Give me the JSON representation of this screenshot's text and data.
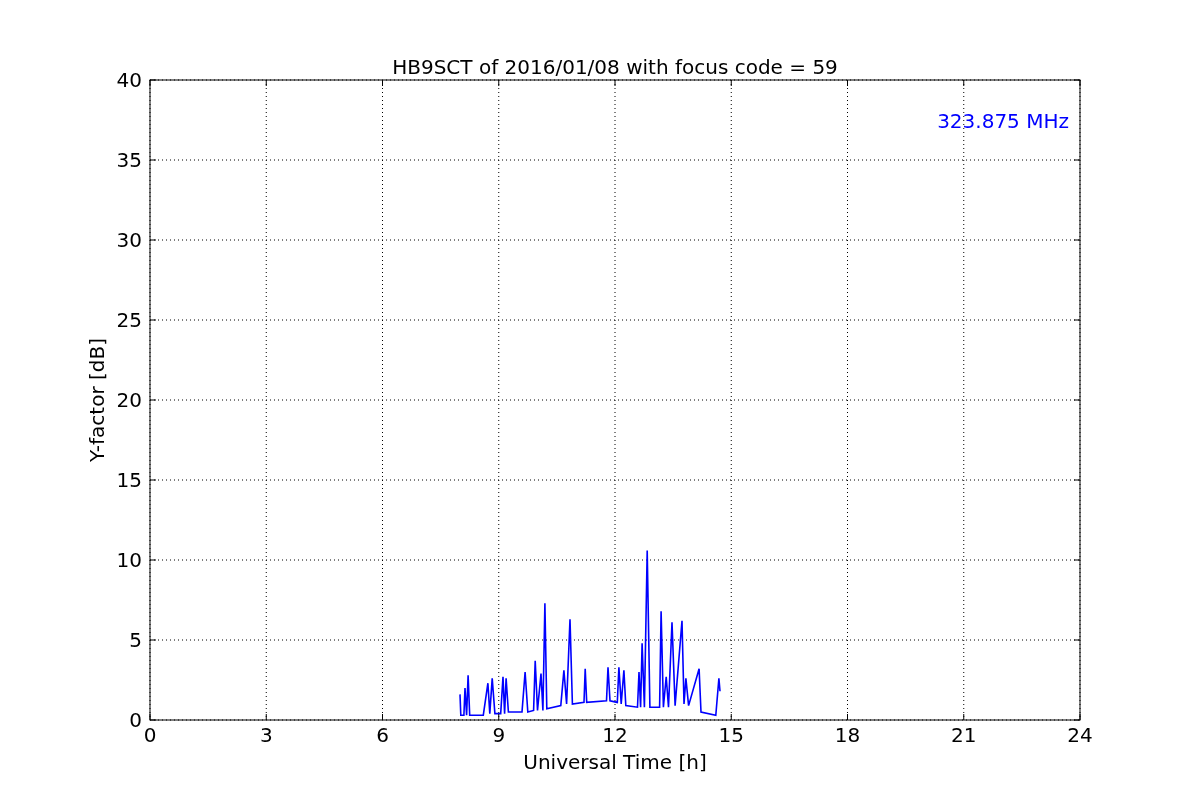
{
  "chart": {
    "chart_data": {
      "type": "line",
      "title": "HB9SCT of 2016/01/08 with focus code = 59",
      "xlabel": "Universal Time [h]",
      "ylabel": "Y-factor [dB]",
      "xlim": [
        0,
        24
      ],
      "ylim": [
        0,
        40
      ],
      "xticks": [
        0,
        3,
        6,
        9,
        12,
        15,
        18,
        21,
        24
      ],
      "yticks": [
        0,
        5,
        10,
        15,
        20,
        25,
        30,
        35,
        40
      ],
      "grid": true,
      "annotations": [
        "323.875 MHz"
      ],
      "x": [
        8.0,
        8.02,
        8.1,
        8.13,
        8.17,
        8.21,
        8.25,
        8.6,
        8.72,
        8.77,
        8.83,
        8.9,
        9.05,
        9.11,
        9.15,
        9.19,
        9.25,
        9.6,
        9.68,
        9.75,
        9.9,
        9.94,
        10.0,
        10.09,
        10.14,
        10.19,
        10.24,
        10.6,
        10.68,
        10.75,
        10.84,
        10.9,
        11.2,
        11.23,
        11.27,
        11.78,
        11.82,
        11.87,
        12.06,
        12.1,
        12.16,
        12.23,
        12.28,
        12.58,
        12.62,
        12.66,
        12.7,
        12.76,
        12.83,
        12.9,
        13.15,
        13.19,
        13.25,
        13.32,
        13.38,
        13.47,
        13.55,
        13.73,
        13.78,
        13.83,
        13.9,
        14.17,
        14.22,
        14.6,
        14.68,
        14.71
      ],
      "series": [
        {
          "color": "#0000ff",
          "values": [
            1.6,
            0.3,
            0.3,
            2.0,
            0.3,
            2.8,
            0.3,
            0.3,
            2.3,
            0.4,
            2.6,
            0.4,
            0.4,
            2.7,
            0.4,
            2.6,
            0.5,
            0.5,
            3.0,
            0.5,
            0.6,
            3.7,
            0.6,
            2.9,
            0.6,
            7.3,
            0.7,
            0.9,
            3.1,
            1.0,
            6.3,
            1.0,
            1.1,
            3.2,
            1.1,
            1.2,
            3.3,
            1.2,
            1.1,
            3.3,
            1.0,
            3.1,
            0.9,
            0.8,
            3.0,
            0.8,
            4.8,
            0.8,
            10.6,
            0.8,
            0.8,
            6.8,
            0.8,
            2.7,
            0.8,
            6.1,
            0.9,
            6.2,
            1.0,
            2.6,
            0.9,
            3.2,
            0.5,
            0.3,
            2.6,
            1.8
          ]
        }
      ]
    }
  }
}
